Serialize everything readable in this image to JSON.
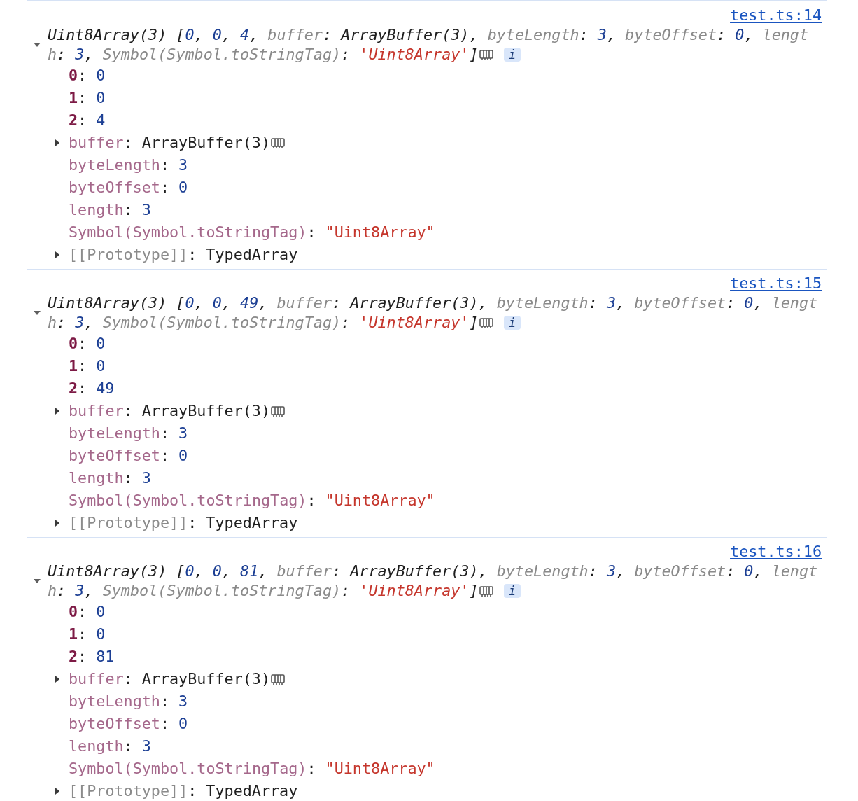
{
  "entries": [
    {
      "source_link": "test.ts:14",
      "expanded": true,
      "summary_lines": [
        [
          {
            "kind": "plain",
            "text": "Uint8Array(3) ["
          },
          {
            "kind": "number",
            "text": "0"
          },
          {
            "kind": "plain",
            "text": ", "
          },
          {
            "kind": "number",
            "text": "0"
          },
          {
            "kind": "plain",
            "text": ", "
          },
          {
            "kind": "number",
            "text": "4"
          },
          {
            "kind": "plain",
            "text": ", "
          },
          {
            "kind": "key",
            "text": "buffer"
          },
          {
            "kind": "plain",
            "text": ": ArrayBuffer(3), "
          },
          {
            "kind": "key",
            "text": "byteLength"
          },
          {
            "kind": "plain",
            "text": ": "
          },
          {
            "kind": "number",
            "text": "3"
          },
          {
            "kind": "plain",
            "text": ", "
          },
          {
            "kind": "key",
            "text": "byteOffset"
          },
          {
            "kind": "plain",
            "text": ": "
          },
          {
            "kind": "number",
            "text": "0"
          },
          {
            "kind": "plain",
            "text": ", "
          },
          {
            "kind": "key",
            "text": "lengt"
          }
        ],
        [
          {
            "kind": "key",
            "text": "h"
          },
          {
            "kind": "plain",
            "text": ": "
          },
          {
            "kind": "number",
            "text": "3"
          },
          {
            "kind": "plain",
            "text": ", "
          },
          {
            "kind": "key",
            "text": "Symbol(Symbol.toStringTag)"
          },
          {
            "kind": "plain",
            "text": ": "
          },
          {
            "kind": "string",
            "text": "'Uint8Array'"
          },
          {
            "kind": "plain",
            "text": "]"
          }
        ]
      ],
      "info_badge": "i",
      "properties": [
        {
          "kind": "index",
          "key": "0",
          "separator": ":",
          "value": {
            "kind": "number",
            "text": "0"
          }
        },
        {
          "kind": "index",
          "key": "1",
          "separator": ":",
          "value": {
            "kind": "number",
            "text": "0"
          }
        },
        {
          "kind": "index",
          "key": "2",
          "separator": ":",
          "value": {
            "kind": "number",
            "text": "4"
          }
        },
        {
          "kind": "own",
          "key": "buffer",
          "separator": ":",
          "value": {
            "kind": "object",
            "text": "ArrayBuffer(3)"
          },
          "expandable": true,
          "expanded": false,
          "memory_icon": true
        },
        {
          "kind": "own",
          "key": "byteLength",
          "separator": ":",
          "value": {
            "kind": "number",
            "text": "3"
          }
        },
        {
          "kind": "own",
          "key": "byteOffset",
          "separator": ":",
          "value": {
            "kind": "number",
            "text": "0"
          }
        },
        {
          "kind": "own",
          "key": "length",
          "separator": ":",
          "value": {
            "kind": "number",
            "text": "3"
          }
        },
        {
          "kind": "own",
          "key": "Symbol(Symbol.toStringTag)",
          "separator": ":",
          "value": {
            "kind": "string",
            "text": "\"Uint8Array\""
          }
        },
        {
          "kind": "internal",
          "key": "[[Prototype]]",
          "separator": ":",
          "value": {
            "kind": "object",
            "text": "TypedArray"
          },
          "expandable": true,
          "expanded": false
        }
      ]
    },
    {
      "source_link": "test.ts:15",
      "expanded": true,
      "summary_lines": [
        [
          {
            "kind": "plain",
            "text": "Uint8Array(3) ["
          },
          {
            "kind": "number",
            "text": "0"
          },
          {
            "kind": "plain",
            "text": ", "
          },
          {
            "kind": "number",
            "text": "0"
          },
          {
            "kind": "plain",
            "text": ", "
          },
          {
            "kind": "number",
            "text": "49"
          },
          {
            "kind": "plain",
            "text": ", "
          },
          {
            "kind": "key",
            "text": "buffer"
          },
          {
            "kind": "plain",
            "text": ": ArrayBuffer(3), "
          },
          {
            "kind": "key",
            "text": "byteLength"
          },
          {
            "kind": "plain",
            "text": ": "
          },
          {
            "kind": "number",
            "text": "3"
          },
          {
            "kind": "plain",
            "text": ", "
          },
          {
            "kind": "key",
            "text": "byteOffset"
          },
          {
            "kind": "plain",
            "text": ": "
          },
          {
            "kind": "number",
            "text": "0"
          },
          {
            "kind": "plain",
            "text": ", "
          },
          {
            "kind": "key",
            "text": "lengt"
          }
        ],
        [
          {
            "kind": "key",
            "text": "h"
          },
          {
            "kind": "plain",
            "text": ": "
          },
          {
            "kind": "number",
            "text": "3"
          },
          {
            "kind": "plain",
            "text": ", "
          },
          {
            "kind": "key",
            "text": "Symbol(Symbol.toStringTag)"
          },
          {
            "kind": "plain",
            "text": ": "
          },
          {
            "kind": "string",
            "text": "'Uint8Array'"
          },
          {
            "kind": "plain",
            "text": "]"
          }
        ]
      ],
      "info_badge": "i",
      "properties": [
        {
          "kind": "index",
          "key": "0",
          "separator": ":",
          "value": {
            "kind": "number",
            "text": "0"
          }
        },
        {
          "kind": "index",
          "key": "1",
          "separator": ":",
          "value": {
            "kind": "number",
            "text": "0"
          }
        },
        {
          "kind": "index",
          "key": "2",
          "separator": ":",
          "value": {
            "kind": "number",
            "text": "49"
          }
        },
        {
          "kind": "own",
          "key": "buffer",
          "separator": ":",
          "value": {
            "kind": "object",
            "text": "ArrayBuffer(3)"
          },
          "expandable": true,
          "expanded": false,
          "memory_icon": true
        },
        {
          "kind": "own",
          "key": "byteLength",
          "separator": ":",
          "value": {
            "kind": "number",
            "text": "3"
          }
        },
        {
          "kind": "own",
          "key": "byteOffset",
          "separator": ":",
          "value": {
            "kind": "number",
            "text": "0"
          }
        },
        {
          "kind": "own",
          "key": "length",
          "separator": ":",
          "value": {
            "kind": "number",
            "text": "3"
          }
        },
        {
          "kind": "own",
          "key": "Symbol(Symbol.toStringTag)",
          "separator": ":",
          "value": {
            "kind": "string",
            "text": "\"Uint8Array\""
          }
        },
        {
          "kind": "internal",
          "key": "[[Prototype]]",
          "separator": ":",
          "value": {
            "kind": "object",
            "text": "TypedArray"
          },
          "expandable": true,
          "expanded": false
        }
      ]
    },
    {
      "source_link": "test.ts:16",
      "expanded": true,
      "summary_lines": [
        [
          {
            "kind": "plain",
            "text": "Uint8Array(3) ["
          },
          {
            "kind": "number",
            "text": "0"
          },
          {
            "kind": "plain",
            "text": ", "
          },
          {
            "kind": "number",
            "text": "0"
          },
          {
            "kind": "plain",
            "text": ", "
          },
          {
            "kind": "number",
            "text": "81"
          },
          {
            "kind": "plain",
            "text": ", "
          },
          {
            "kind": "key",
            "text": "buffer"
          },
          {
            "kind": "plain",
            "text": ": ArrayBuffer(3), "
          },
          {
            "kind": "key",
            "text": "byteLength"
          },
          {
            "kind": "plain",
            "text": ": "
          },
          {
            "kind": "number",
            "text": "3"
          },
          {
            "kind": "plain",
            "text": ", "
          },
          {
            "kind": "key",
            "text": "byteOffset"
          },
          {
            "kind": "plain",
            "text": ": "
          },
          {
            "kind": "number",
            "text": "0"
          },
          {
            "kind": "plain",
            "text": ", "
          },
          {
            "kind": "key",
            "text": "lengt"
          }
        ],
        [
          {
            "kind": "key",
            "text": "h"
          },
          {
            "kind": "plain",
            "text": ": "
          },
          {
            "kind": "number",
            "text": "3"
          },
          {
            "kind": "plain",
            "text": ", "
          },
          {
            "kind": "key",
            "text": "Symbol(Symbol.toStringTag)"
          },
          {
            "kind": "plain",
            "text": ": "
          },
          {
            "kind": "string",
            "text": "'Uint8Array'"
          },
          {
            "kind": "plain",
            "text": "]"
          }
        ]
      ],
      "info_badge": "i",
      "properties": [
        {
          "kind": "index",
          "key": "0",
          "separator": ":",
          "value": {
            "kind": "number",
            "text": "0"
          }
        },
        {
          "kind": "index",
          "key": "1",
          "separator": ":",
          "value": {
            "kind": "number",
            "text": "0"
          }
        },
        {
          "kind": "index",
          "key": "2",
          "separator": ":",
          "value": {
            "kind": "number",
            "text": "81"
          }
        },
        {
          "kind": "own",
          "key": "buffer",
          "separator": ":",
          "value": {
            "kind": "object",
            "text": "ArrayBuffer(3)"
          },
          "expandable": true,
          "expanded": false,
          "memory_icon": true
        },
        {
          "kind": "own",
          "key": "byteLength",
          "separator": ":",
          "value": {
            "kind": "number",
            "text": "3"
          }
        },
        {
          "kind": "own",
          "key": "byteOffset",
          "separator": ":",
          "value": {
            "kind": "number",
            "text": "0"
          }
        },
        {
          "kind": "own",
          "key": "length",
          "separator": ":",
          "value": {
            "kind": "number",
            "text": "3"
          }
        },
        {
          "kind": "own",
          "key": "Symbol(Symbol.toStringTag)",
          "separator": ":",
          "value": {
            "kind": "string",
            "text": "\"Uint8Array\""
          }
        },
        {
          "kind": "internal",
          "key": "[[Prototype]]",
          "separator": ":",
          "value": {
            "kind": "object",
            "text": "TypedArray"
          },
          "expandable": true,
          "expanded": false
        }
      ]
    }
  ]
}
